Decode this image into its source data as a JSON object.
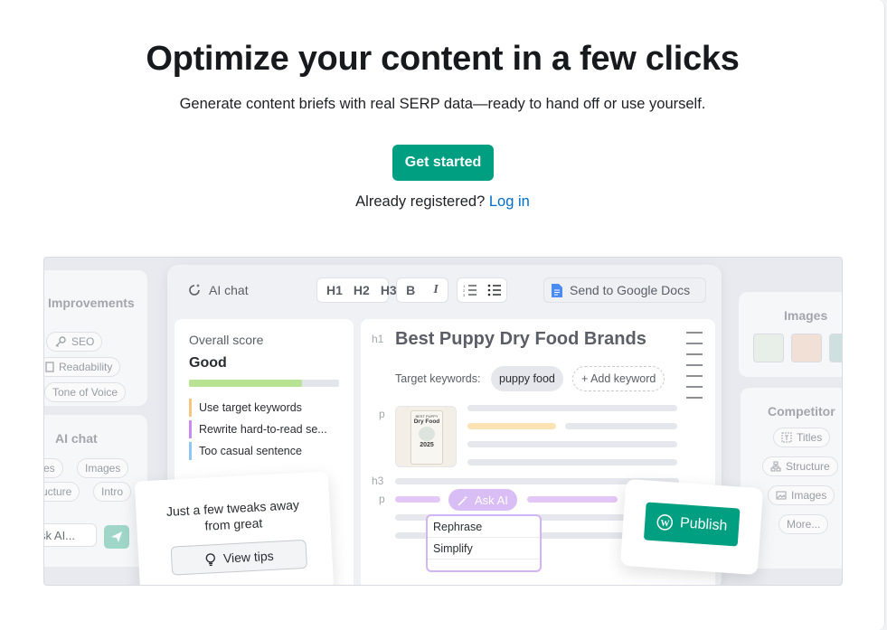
{
  "hero": {
    "title": "Optimize your content in a few clicks",
    "subtitle": "Generate content briefs with real SERP data—ready to hand off or use yourself.",
    "cta_label": "Get started",
    "login_prompt": "Already registered?",
    "login_link": "Log in"
  },
  "preview": {
    "left": {
      "improvements_title": "Improvements",
      "improvement_chips": [
        "SEO",
        "Readability",
        "Tone of Voice"
      ],
      "ai_chat_title": "AI chat",
      "ai_chips": [
        "tles",
        "Images",
        "ructure",
        "Intro"
      ],
      "ask_placeholder": "sk AI..."
    },
    "editor": {
      "ai_chat_label": "AI chat",
      "headings": [
        "H1",
        "H2",
        "H3"
      ],
      "format": [
        "B",
        "I"
      ],
      "send_label": "Send to Google Docs",
      "score_label": "Overall score",
      "score_value": "Good",
      "score_fraction": 0.75,
      "tips": [
        {
          "text": "Use target keywords",
          "color": "#f5c77e"
        },
        {
          "text": "Rewrite hard-to-read se...",
          "color": "#c98af2"
        },
        {
          "text": "Too casual sentence",
          "color": "#8fc7f2"
        }
      ],
      "doc_tag_h1": "h1",
      "doc_title": "Best Puppy Dry Food Brands",
      "target_kw_label": "Target keywords:",
      "keyword": "puppy food",
      "add_keyword": "+ Add keyword",
      "tag_p": "p",
      "tag_h3": "h3",
      "ask_ai": "Ask AI",
      "menu": [
        "Rephrase",
        "Simplify"
      ],
      "product_label": "Dry Food",
      "product_year": "2025",
      "product_top": "BEST PUPPY"
    },
    "tips_popover": {
      "text": "Just a few tweaks away from great",
      "button": "View tips"
    },
    "right": {
      "images_title": "Images",
      "competitor_title": "Competitor",
      "chips": [
        "Titles",
        "Structure",
        "Images",
        "More..."
      ]
    },
    "publish_label": "Publish",
    "colors": {
      "brand": "#009f81",
      "link": "#006dca",
      "ai_purple": "#c7a3f2"
    }
  }
}
